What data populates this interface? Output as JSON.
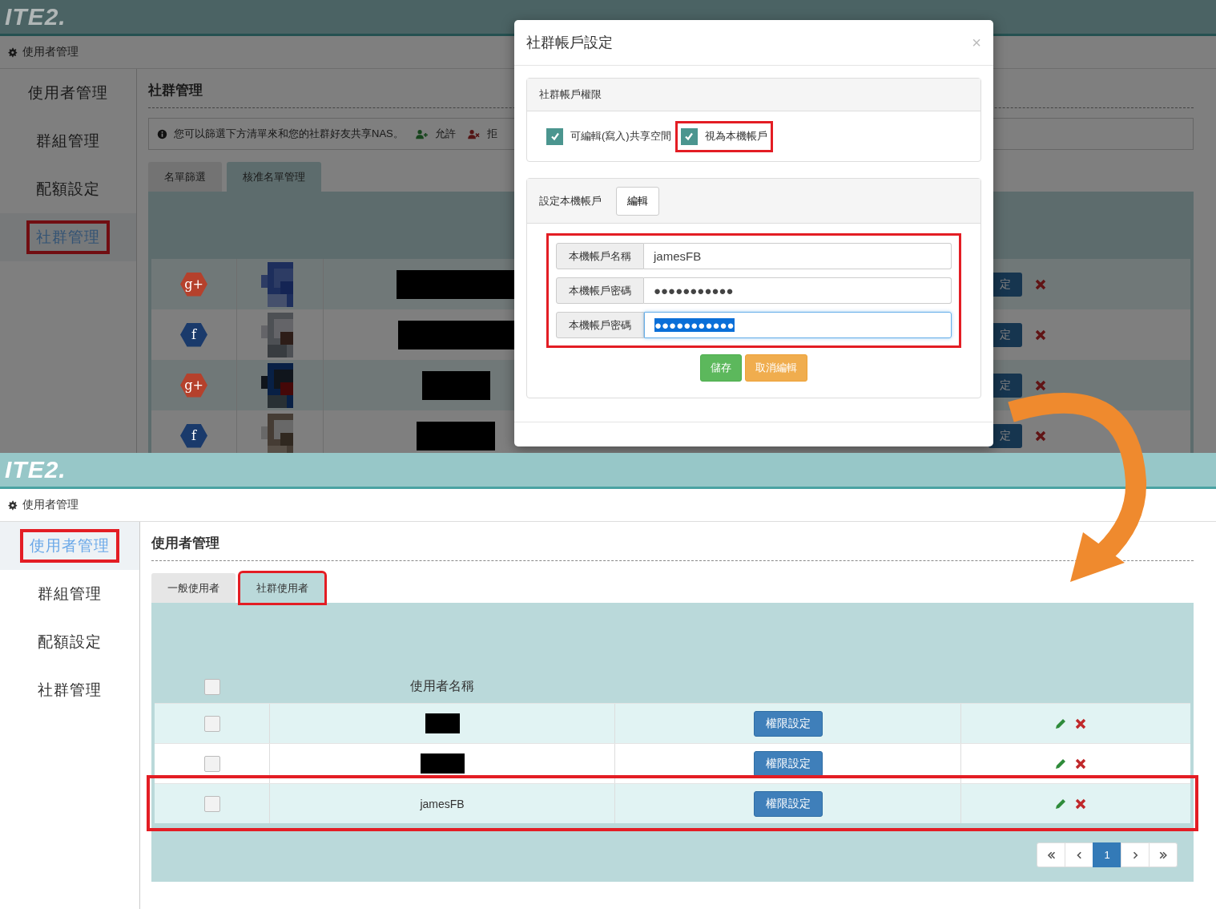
{
  "top_screen": {
    "logo": "ITE2.",
    "breadcrumb": "使用者管理",
    "sidebar": [
      {
        "label": "使用者管理",
        "selected": false,
        "highlighted": false
      },
      {
        "label": "群組管理",
        "selected": false,
        "highlighted": false
      },
      {
        "label": "配額設定",
        "selected": false,
        "highlighted": false
      },
      {
        "label": "社群管理",
        "selected": true,
        "highlighted": true
      }
    ],
    "heading": "社群管理",
    "notice": "您可以篩選下方清單來和您的社群好友共享NAS。",
    "legend": [
      {
        "kind": "allow",
        "label": "允許"
      },
      {
        "kind": "deny",
        "label": "拒"
      }
    ],
    "tabs": [
      {
        "label": "名單篩選",
        "selected": false
      },
      {
        "label": "核准名單管理",
        "selected": true
      }
    ],
    "rows": [
      {
        "badge": "g+",
        "color": "#b5412c",
        "button": "定"
      },
      {
        "badge": "f",
        "color": "#1a3a6b",
        "button": "定"
      },
      {
        "badge": "g+",
        "color": "#b5412c",
        "button": "定"
      },
      {
        "badge": "f",
        "color": "#1a3a6b",
        "button": "定"
      }
    ]
  },
  "modal": {
    "title": "社群帳戶設定",
    "close": "×",
    "permissions": {
      "title": "社群帳戶權限",
      "options": [
        {
          "label": "可編輯(寫入)共享空間",
          "checked": true,
          "highlighted": false
        },
        {
          "label": "視為本機帳戶",
          "checked": true,
          "highlighted": true
        }
      ]
    },
    "local_account": {
      "title": "設定本機帳戶",
      "edit_button": "編輯",
      "fields_highlighted": true,
      "fields": [
        {
          "label": "本機帳戶名稱",
          "value": "jamesFB",
          "focused": false,
          "text_selected": false
        },
        {
          "label": "本機帳戶密碼",
          "value": "●●●●●●●●●●●",
          "focused": false,
          "text_selected": false
        },
        {
          "label": "本機帳戶密碼",
          "value": "●●●●●●●●●●●",
          "focused": true,
          "text_selected": true
        }
      ],
      "buttons": [
        {
          "label": "儲存",
          "kind": "success"
        },
        {
          "label": "取消編輯",
          "kind": "warning"
        }
      ]
    }
  },
  "bottom_screen": {
    "logo": "ITE2.",
    "breadcrumb": "使用者管理",
    "sidebar": [
      {
        "label": "使用者管理",
        "selected": true,
        "highlighted": true
      },
      {
        "label": "群組管理",
        "selected": false,
        "highlighted": false
      },
      {
        "label": "配額設定",
        "selected": false,
        "highlighted": false
      },
      {
        "label": "社群管理",
        "selected": false,
        "highlighted": false
      }
    ],
    "heading": "使用者管理",
    "tabs": [
      {
        "label": "一般使用者",
        "selected": false,
        "highlighted": false
      },
      {
        "label": "社群使用者",
        "selected": true,
        "highlighted": true
      }
    ],
    "table": {
      "select_all_checked": false,
      "column_header": "使用者名稱",
      "rows": [
        {
          "redacted": true,
          "checked": false,
          "button": "權限設定",
          "highlighted": false
        },
        {
          "redacted": true,
          "checked": false,
          "button": "權限設定",
          "highlighted": false
        },
        {
          "redacted": false,
          "name": "jamesFB",
          "checked": false,
          "button": "權限設定",
          "highlighted": true
        }
      ]
    },
    "pagination": [
      {
        "kind": "first",
        "selected": false
      },
      {
        "kind": "prev",
        "selected": false
      },
      {
        "kind": "page",
        "label": "1",
        "selected": true
      },
      {
        "kind": "next",
        "selected": false
      },
      {
        "kind": "last",
        "selected": false
      }
    ]
  }
}
